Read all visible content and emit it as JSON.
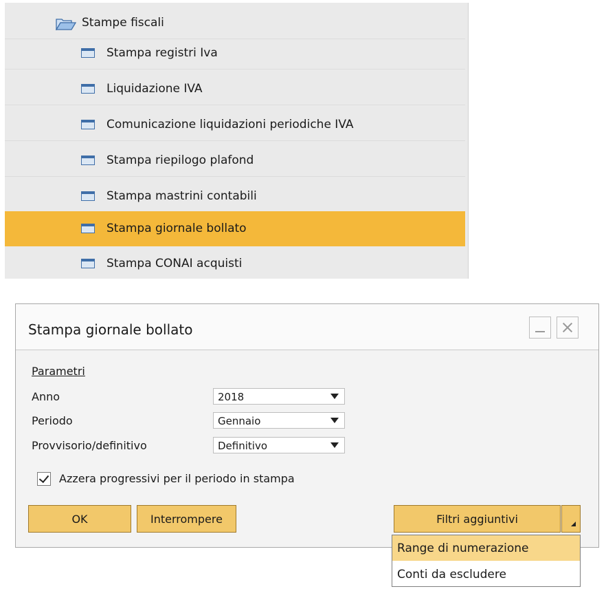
{
  "menu": {
    "folder": {
      "label": "Stampe fiscali",
      "icon": "folder-open-icon"
    },
    "items": [
      {
        "label": "Stampa registri Iva"
      },
      {
        "label": "Liquidazione IVA"
      },
      {
        "label": "Comunicazione liquidazioni periodiche IVA"
      },
      {
        "label": "Stampa riepilogo plafond"
      },
      {
        "label": "Stampa mastrini contabili"
      },
      {
        "label": "Stampa giornale bollato"
      },
      {
        "label": "Stampa CONAI acquisti"
      }
    ],
    "selected_label": "Stampa giornale bollato",
    "selected_color": "#f4b83a"
  },
  "dialog": {
    "title": "Stampa giornale bollato",
    "section": "Parametri",
    "fields": [
      {
        "label": "Anno",
        "value": "2018"
      },
      {
        "label": "Periodo",
        "value": "Gennaio"
      },
      {
        "label": "Provvisorio/definitivo",
        "value": "Definitivo"
      }
    ],
    "checkbox": {
      "label": "Azzera progressivi per il periodo in stampa",
      "checked": true
    },
    "buttons": {
      "ok": "OK",
      "stop": "Interrompere",
      "filters": "Filtri aggiuntivi"
    },
    "button_color": "#f2c86a"
  },
  "dropdown": {
    "items": [
      {
        "label": "Range di numerazione",
        "highlighted": true
      },
      {
        "label": "Conti da escludere",
        "highlighted": false
      }
    ],
    "highlight_color": "#f8d78a"
  }
}
